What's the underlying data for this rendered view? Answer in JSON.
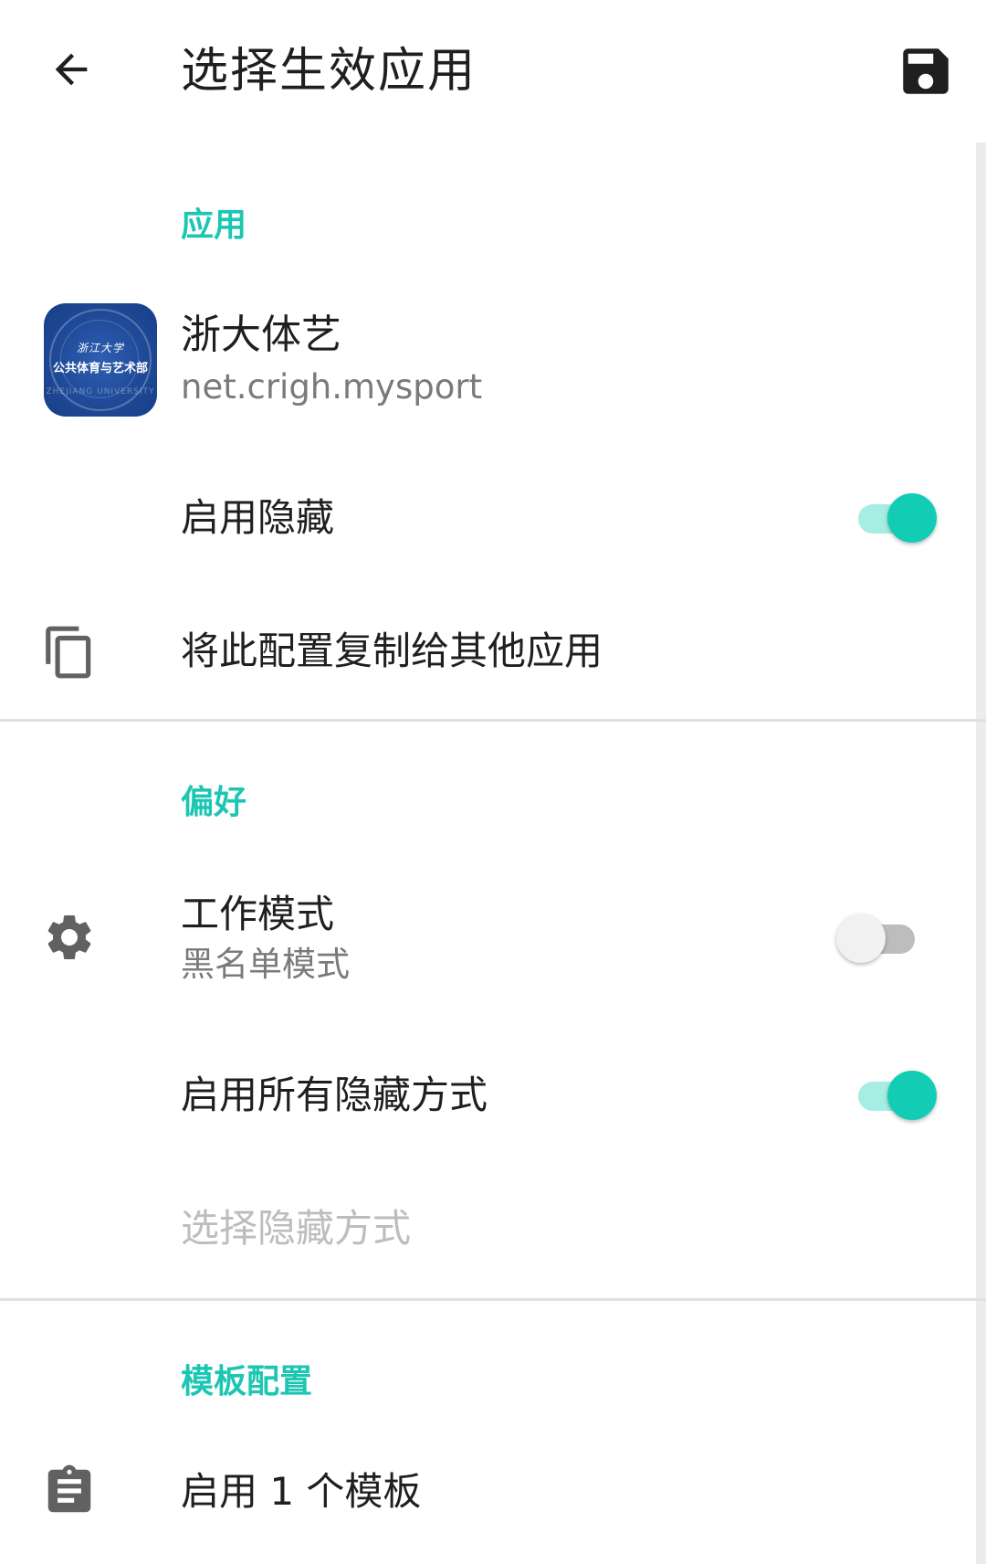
{
  "appbar": {
    "title": "选择生效应用",
    "back_icon": "arrow-back-icon",
    "save_icon": "floppy-save-icon"
  },
  "colors": {
    "accent": "#1cc6b2",
    "switch_on_thumb": "#12cdb4",
    "switch_on_track": "#a6ede3",
    "text_primary": "#1f1f1f",
    "text_secondary": "#7a7a7a",
    "text_disabled": "#bdbdbd"
  },
  "sections": {
    "app": {
      "header": "应用",
      "app_name": "浙大体艺",
      "package": "net.crigh.mysport",
      "app_icon_text": {
        "line1": "浙江大学",
        "line2": "公共体育与艺术部",
        "line3": "ZHEJIANG UNIVERSITY"
      },
      "enable_hide": {
        "label": "启用隐藏",
        "on": true
      },
      "copy_config": {
        "label": "将此配置复制给其他应用",
        "icon": "copy-icon"
      }
    },
    "preferences": {
      "header": "偏好",
      "work_mode": {
        "label": "工作模式",
        "value": "黑名单模式",
        "icon": "gear-icon",
        "on": false
      },
      "enable_all_methods": {
        "label": "启用所有隐藏方式",
        "on": true
      },
      "select_methods": {
        "label": "选择隐藏方式"
      }
    },
    "templates": {
      "header": "模板配置",
      "enabled_templates": {
        "label": "启用 1 个模板",
        "icon": "clipboard-icon"
      }
    }
  }
}
